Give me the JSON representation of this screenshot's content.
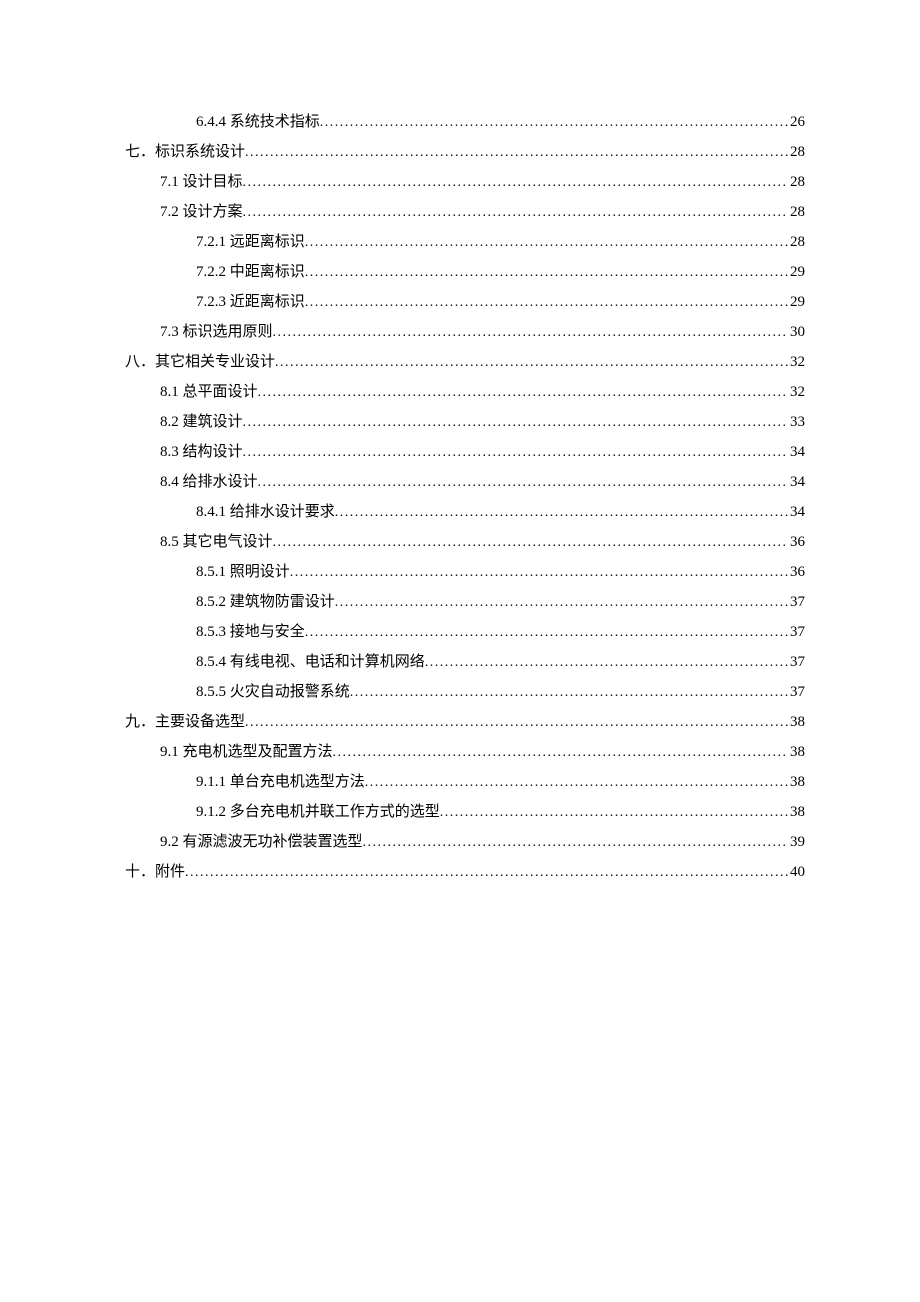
{
  "toc": [
    {
      "level": 4,
      "label": "6.4.4  系统技术指标",
      "page": "26"
    },
    {
      "level": 2,
      "label": "七．标识系统设计",
      "page": "28"
    },
    {
      "level": 3,
      "label": "7.1  设计目标",
      "page": "28"
    },
    {
      "level": 3,
      "label": "7.2  设计方案",
      "page": "28"
    },
    {
      "level": 4,
      "label": "7.2.1  远距离标识",
      "page": "28"
    },
    {
      "level": 4,
      "label": "7.2.2  中距离标识",
      "page": "29"
    },
    {
      "level": 4,
      "label": "7.2.3  近距离标识",
      "page": "29"
    },
    {
      "level": 3,
      "label": "7.3  标识选用原则",
      "page": "30"
    },
    {
      "level": 2,
      "label": "八．其它相关专业设计",
      "page": "32"
    },
    {
      "level": 3,
      "label": "8.1  总平面设计",
      "page": "32"
    },
    {
      "level": 3,
      "label": "8.2  建筑设计",
      "page": "33"
    },
    {
      "level": 3,
      "label": "8.3  结构设计",
      "page": "34"
    },
    {
      "level": 3,
      "label": "8.4  给排水设计",
      "page": "34"
    },
    {
      "level": 4,
      "label": "8.4.1  给排水设计要求",
      "page": "34"
    },
    {
      "level": 3,
      "label": "8.5  其它电气设计",
      "page": "36"
    },
    {
      "level": 4,
      "label": "8.5.1  照明设计",
      "page": "36"
    },
    {
      "level": 4,
      "label": "8.5.2  建筑物防雷设计",
      "page": "37"
    },
    {
      "level": 4,
      "label": "8.5.3  接地与安全",
      "page": "37"
    },
    {
      "level": 4,
      "label": "8.5.4 有线电视、电话和计算机网络",
      "page": "37"
    },
    {
      "level": 4,
      "label": "8.5.5  火灾自动报警系统",
      "page": "37"
    },
    {
      "level": 2,
      "label": "九．主要设备选型",
      "page": "38"
    },
    {
      "level": 3,
      "label": "9.1  充电机选型及配置方法",
      "page": "38"
    },
    {
      "level": 4,
      "label": "9.1.1  单台充电机选型方法",
      "page": "38"
    },
    {
      "level": 4,
      "label": "9.1.2  多台充电机并联工作方式的选型",
      "page": "38"
    },
    {
      "level": 3,
      "label": "9.2  有源滤波无功补偿装置选型",
      "page": "39"
    },
    {
      "level": 2,
      "label": "十．附件",
      "page": "40"
    }
  ]
}
